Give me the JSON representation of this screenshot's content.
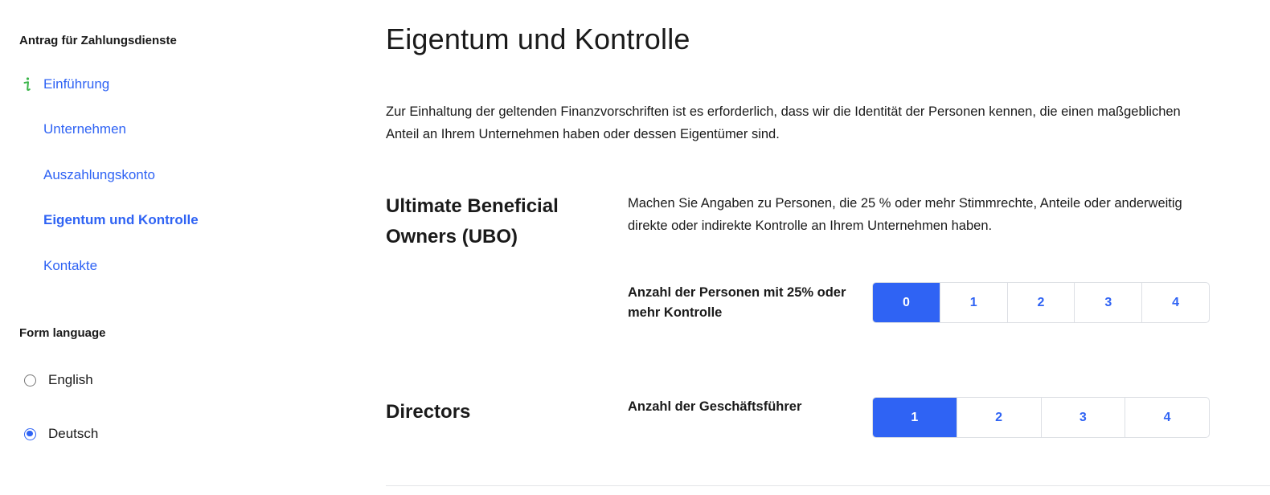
{
  "sidebar": {
    "heading": "Antrag für Zahlungsdienste",
    "items": [
      {
        "label": "Einführung",
        "icon": "info-icon"
      },
      {
        "label": "Unternehmen"
      },
      {
        "label": "Auszahlungskonto"
      },
      {
        "label": "Eigentum und Kontrolle",
        "active": true
      },
      {
        "label": "Kontakte"
      }
    ],
    "language": {
      "heading": "Form language",
      "options": [
        {
          "label": "English",
          "checked": false
        },
        {
          "label": "Deutsch",
          "checked": true
        }
      ]
    }
  },
  "main": {
    "title": "Eigentum und Kontrolle",
    "intro": "Zur Einhaltung der geltenden Finanzvorschriften ist es erforderlich, dass wir die Identität der Personen kennen, die einen maßgeblichen Anteil an Ihrem Unternehmen haben oder dessen Eigentümer sind.",
    "ubo": {
      "title": "Ultimate Beneficial Owners (UBO)",
      "description": "Machen Sie Angaben zu Personen, die 25 % oder mehr Stimmrechte, Anteile oder anderweitig direkte oder indirekte Kontrolle an Ihrem Unternehmen haben.",
      "field_label": "Anzahl der Personen mit 25% oder mehr Kontrolle",
      "options": [
        "0",
        "1",
        "2",
        "3",
        "4"
      ],
      "selected": "0"
    },
    "directors": {
      "title": "Directors",
      "field_label": "Anzahl der Geschäftsführer",
      "options": [
        "1",
        "2",
        "3",
        "4"
      ],
      "selected": "1"
    }
  },
  "colors": {
    "accent": "#2f63f4",
    "info_icon": "#3bb54a",
    "border": "#dcdfe4"
  }
}
